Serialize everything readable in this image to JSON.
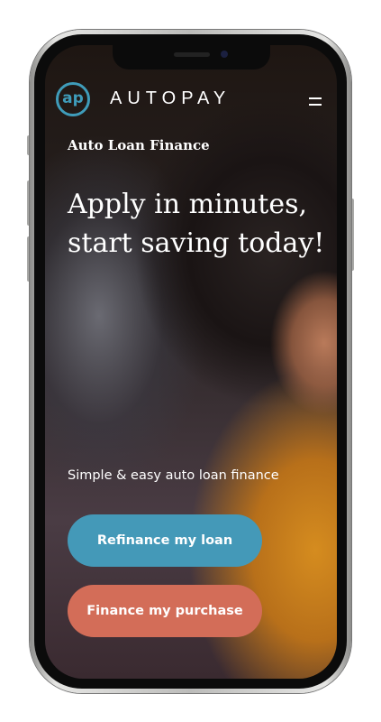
{
  "header": {
    "logo_text": "ap",
    "brand": "AUTOPAY",
    "menu_icon": "hamburger-icon"
  },
  "hero": {
    "eyebrow": "Auto Loan Finance",
    "headline": "Apply in minutes, start saving today!",
    "subtitle": "Simple & easy auto loan finance"
  },
  "buttons": {
    "refinance": "Refinance my loan",
    "finance": "Finance my purchase"
  },
  "colors": {
    "accent_blue": "#4499b8",
    "accent_coral": "#d36d58"
  }
}
